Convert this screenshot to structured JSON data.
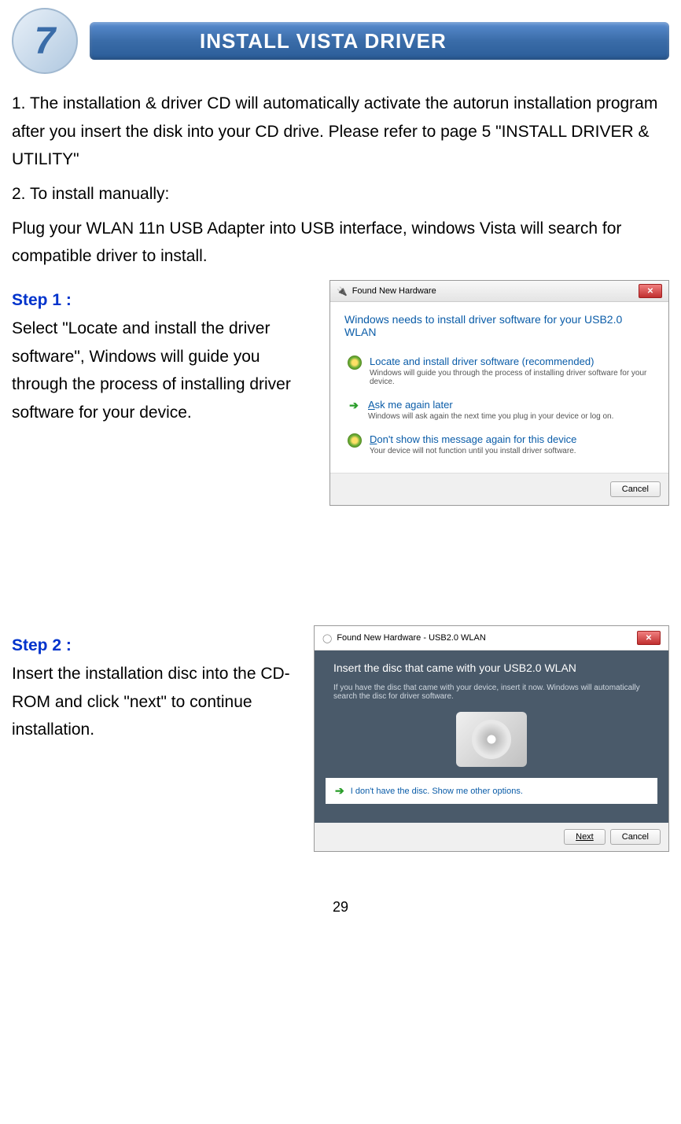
{
  "banner": {
    "number": "7",
    "title": "INSTALL VISTA DRIVER"
  },
  "intro": {
    "item1": "1.    The installation & driver CD will automatically activate the autorun installation program after you insert the disk into your CD drive. Please refer to page 5 \"INSTALL DRIVER & UTILITY\"",
    "item2": "2.    To install manually:",
    "plug": "Plug your WLAN 11n USB Adapter into USB interface, windows Vista will search for compatible driver to install."
  },
  "step1": {
    "label": "Step 1 :",
    "text": "Select \"Locate and install the driver software\", Windows will guide you through the process of installing driver software for your device.",
    "dialog": {
      "title": "Found New Hardware",
      "heading": "Windows needs to install driver software for your USB2.0 WLAN",
      "opt1_title": "Locate and install driver software (recommended)",
      "opt1_desc": "Windows will guide you through the process of installing driver software for your device.",
      "opt2_title_a": "A",
      "opt2_title_rest": "sk me again later",
      "opt2_desc": "Windows will ask again the next time you plug in your device or log on.",
      "opt3_title_a": "D",
      "opt3_title_rest": "on't show this message again for this device",
      "opt3_desc": "Your device will not function until you install driver software.",
      "cancel": "Cancel"
    }
  },
  "step2": {
    "label": "Step 2 :",
    "text": "Insert the installation disc into the CD-ROM and click \"next\" to continue installation.",
    "dialog": {
      "title": "Found New Hardware - USB2.0 WLAN",
      "heading": "Insert the disc that came with your USB2.0 WLAN",
      "sub": "If you have the disc that came with your device, insert it now.  Windows will automatically search the disc for driver software.",
      "link": "I don't have the disc. Show me other options.",
      "next": "Next",
      "cancel": "Cancel"
    }
  },
  "page_number": "29"
}
